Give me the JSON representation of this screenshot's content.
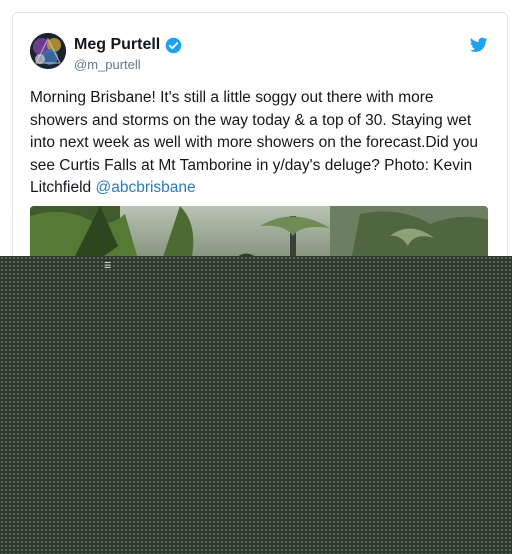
{
  "tweet": {
    "author": {
      "display_name": "Meg Purtell",
      "handle": "@m_purtell",
      "verified": true
    },
    "text_main": "Morning Brisbane! It's still a little soggy out there with more showers and storms on the way today & a top of 30. Staying wet into next week as well with more showers on the forecast.Did you see Curtis Falls at Mt Tamborine in y/day's deluge? Photo: Kevin Litchfield ",
    "mention": "@abcbrisbane"
  },
  "colors": {
    "twitter_blue": "#1da1f2",
    "link": "#2b7bb9",
    "text": "#14171a",
    "muted": "#657786",
    "border": "#e1e8ed"
  },
  "icons": {
    "verified": "verified-badge-icon",
    "brand": "twitter-bird-icon"
  }
}
